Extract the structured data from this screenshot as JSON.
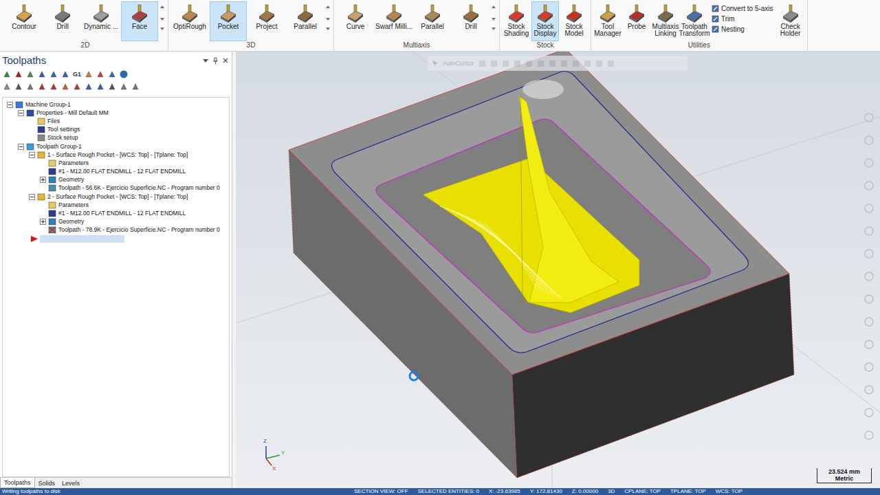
{
  "window": {
    "title": "Mastercam"
  },
  "ribbon": {
    "groups": [
      {
        "label": "2D",
        "buttons": [
          {
            "label": "Contour",
            "kind": "large",
            "selected": false
          },
          {
            "label": "Drill",
            "kind": "large",
            "selected": false
          },
          {
            "label": "Dynamic ...",
            "kind": "large",
            "selected": false
          },
          {
            "label": "Face",
            "kind": "large",
            "selected": true
          }
        ]
      },
      {
        "label": "3D",
        "buttons": [
          {
            "label": "OptiRough",
            "kind": "large",
            "selected": false
          },
          {
            "label": "Pocket",
            "kind": "large",
            "selected": true
          },
          {
            "label": "Project",
            "kind": "large",
            "selected": false
          },
          {
            "label": "Parallel",
            "kind": "large",
            "selected": false
          }
        ]
      },
      {
        "label": "Multiaxis",
        "buttons": [
          {
            "label": "Curve",
            "kind": "large",
            "selected": false
          },
          {
            "label": "Swarf Milli...",
            "kind": "large",
            "selected": false
          },
          {
            "label": "Parallel",
            "kind": "large",
            "selected": false
          },
          {
            "label": "Drill",
            "kind": "large",
            "selected": false
          }
        ]
      },
      {
        "label": "Stock",
        "buttons": [
          {
            "label": "Stock Shading",
            "kind": "large",
            "selected": false
          },
          {
            "label": "Stock Display",
            "kind": "large",
            "selected": true
          },
          {
            "label": "Stock Model",
            "kind": "large",
            "selected": false
          }
        ]
      },
      {
        "label": "Utilities",
        "buttons": [
          {
            "label": "Tool Manager",
            "kind": "large",
            "selected": false
          },
          {
            "label": "Probe",
            "kind": "large",
            "selected": false
          },
          {
            "label": "Multiaxis Linking",
            "kind": "large",
            "selected": false
          },
          {
            "label": "Toolpath Transform",
            "kind": "large",
            "selected": false
          },
          {
            "label": "Convert to 5-axis",
            "kind": "small",
            "selected": false
          },
          {
            "label": "Trim",
            "kind": "small",
            "selected": false
          },
          {
            "label": "Nesting",
            "kind": "small",
            "selected": false
          },
          {
            "label": "Check Holder",
            "kind": "large",
            "selected": false
          }
        ]
      }
    ]
  },
  "panel": {
    "title": "Toolpaths",
    "toolbar_label": "G1",
    "tree": [
      {
        "label": "Machine Group-1",
        "depth": 0,
        "kind": "machine",
        "expandable": true,
        "expanded": true,
        "dirty": false
      },
      {
        "label": "Properties - Mill Default MM",
        "depth": 1,
        "kind": "properties",
        "expandable": true,
        "expanded": true,
        "dirty": false
      },
      {
        "label": "Files",
        "depth": 2,
        "kind": "folder",
        "expandable": false,
        "expanded": false,
        "dirty": false
      },
      {
        "label": "Tool settings",
        "depth": 2,
        "kind": "tool",
        "expandable": false,
        "expanded": false,
        "dirty": false
      },
      {
        "label": "Stock setup",
        "depth": 2,
        "kind": "stock",
        "expandable": false,
        "expanded": false,
        "dirty": false
      },
      {
        "label": "Toolpath Group-1",
        "depth": 1,
        "kind": "group",
        "expandable": true,
        "expanded": true,
        "dirty": false
      },
      {
        "label": "1 - Surface Rough Pocket - [WCS: Top] - [Tplane: Top]",
        "depth": 2,
        "kind": "operation",
        "expandable": true,
        "expanded": true,
        "dirty": false
      },
      {
        "label": "Parameters",
        "depth": 3,
        "kind": "params",
        "expandable": false,
        "expanded": false,
        "dirty": false
      },
      {
        "label": "#1 - M12.00 FLAT ENDMILL - 12 FLAT ENDMILL",
        "depth": 3,
        "kind": "tool",
        "expandable": false,
        "expanded": false,
        "dirty": false
      },
      {
        "label": "Geometry",
        "depth": 3,
        "kind": "geometry",
        "expandable": true,
        "expanded": false,
        "dirty": false
      },
      {
        "label": "Toolpath - 56.6K - Ejercicio Superficie.NC - Program number 0",
        "depth": 3,
        "kind": "toolpath",
        "expandable": false,
        "expanded": false,
        "dirty": false
      },
      {
        "label": "2 - Surface Rough Pocket - [WCS: Top] - [Tplane: Top]",
        "depth": 2,
        "kind": "operation",
        "expandable": true,
        "expanded": true,
        "dirty": false
      },
      {
        "label": "Parameters",
        "depth": 3,
        "kind": "params",
        "expandable": false,
        "expanded": false,
        "dirty": false
      },
      {
        "label": "#1 - M12.00 FLAT ENDMILL - 12 FLAT ENDMILL",
        "depth": 3,
        "kind": "tool",
        "expandable": false,
        "expanded": false,
        "dirty": false
      },
      {
        "label": "Geometry",
        "depth": 3,
        "kind": "geometry",
        "expandable": true,
        "expanded": false,
        "dirty": false
      },
      {
        "label": "Toolpath - 78.9K - Ejercicio Superficie.NC - Program number 0",
        "depth": 3,
        "kind": "toolpath",
        "expandable": false,
        "expanded": false,
        "dirty": true
      },
      {
        "label": "",
        "depth": 2,
        "kind": "insert",
        "expandable": false,
        "expanded": false,
        "dirty": false
      }
    ],
    "tabs": [
      {
        "label": "Toolpaths",
        "selected": true
      },
      {
        "label": "Solids",
        "selected": false
      },
      {
        "label": "Levels",
        "selected": false
      }
    ]
  },
  "viewport": {
    "autocursor": "AutoCursor",
    "scale": {
      "value": "23.524 mm",
      "unit": "Metric"
    },
    "axes": {
      "x": "X",
      "y": "Y",
      "z": "Z"
    }
  },
  "status_bar": [
    "Writing toolpaths to disk",
    "SECTION VIEW: OFF",
    "SELECTED ENTITIES: 0",
    "X: -23.63985",
    "Y: 172.81430",
    "Z: 0.00000",
    "3D",
    "CPLANE: TOP",
    "TPLANE: TOP",
    "WCS: TOP"
  ]
}
